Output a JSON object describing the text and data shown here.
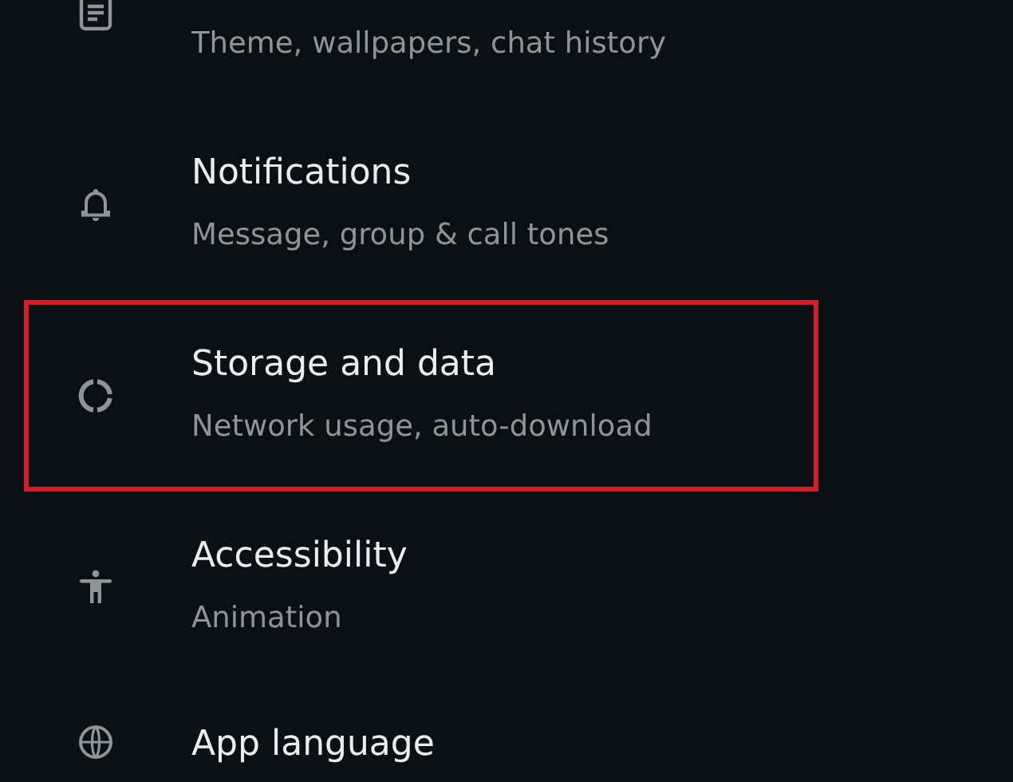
{
  "settings": [
    {
      "kind": "document",
      "subtitle": "Theme, wallpapers, chat history",
      "highlighted": false
    },
    {
      "kind": "bell",
      "title": "Notifications",
      "subtitle": "Message, group & call tones",
      "highlighted": false
    },
    {
      "kind": "storage",
      "title": "Storage and data",
      "subtitle": "Network usage, auto-download",
      "highlighted": true
    },
    {
      "kind": "accessibility",
      "title": "Accessibility",
      "subtitle": "Animation",
      "highlighted": false
    },
    {
      "kind": "globe",
      "title": "App language",
      "highlighted": false
    }
  ]
}
